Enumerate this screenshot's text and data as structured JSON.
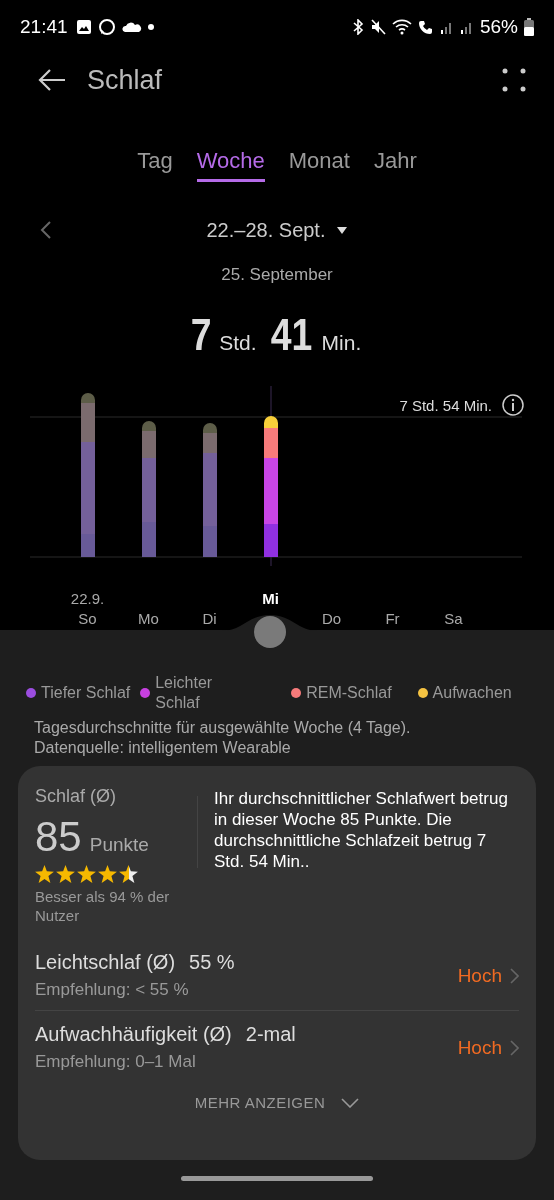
{
  "status_bar": {
    "time": "21:41",
    "battery": "56%"
  },
  "header": {
    "title": "Schlaf"
  },
  "tabs": [
    {
      "label": "Tag",
      "selected": false
    },
    {
      "label": "Woche",
      "selected": true
    },
    {
      "label": "Monat",
      "selected": false
    },
    {
      "label": "Jahr",
      "selected": false
    }
  ],
  "date_range": "22.–28. Sept.",
  "selected_date": "25. September",
  "duration": {
    "hours": "7",
    "hours_unit": "Std.",
    "minutes": "41",
    "minutes_unit": "Min."
  },
  "chart": {
    "reference_label": "7 Std. 54 Min."
  },
  "days": [
    {
      "label": "So",
      "date": "22.9.",
      "selected": false
    },
    {
      "label": "Mo",
      "selected": false
    },
    {
      "label": "Di",
      "selected": false
    },
    {
      "label": "Mi",
      "selected": true
    },
    {
      "label": "Do",
      "selected": false
    },
    {
      "label": "Fr",
      "selected": false
    },
    {
      "label": "Sa",
      "selected": false
    }
  ],
  "legend": [
    {
      "label": "Tiefer Schlaf",
      "color": "#9b4de0"
    },
    {
      "label": "Leichter Schlaf",
      "color": "#c740e0"
    },
    {
      "label": "REM-Schlaf",
      "color": "#f77b7b"
    },
    {
      "label": "Aufwachen",
      "color": "#f5c342"
    }
  ],
  "note": [
    "Tagesdurchschnitte für ausgewählte Woche (4 Tage).",
    "Datenquelle: intelligentem Wearable"
  ],
  "score": {
    "title": "Schlaf (Ø)",
    "value": "85",
    "unit": "Punkte",
    "stars": 4.5,
    "comparison": "Besser als 94 % der Nutzer",
    "description": "Ihr durchschnittlicher Schlafwert betrug in dieser Woche 85 Punkte. Die durchschnittliche Schlafzeit betrug 7 Std. 54 Min.."
  },
  "metrics": [
    {
      "name": "Leichtschlaf (Ø)",
      "value": "55 %",
      "recommendation": "Empfehlung: < 55 %",
      "rating": "Hoch"
    },
    {
      "name": "Aufwachhäufigkeit (Ø)",
      "value": "2-mal",
      "recommendation": "Empfehlung: 0–1 Mal",
      "rating": "Hoch"
    }
  ],
  "more_button": "MEHR ANZEIGEN"
}
